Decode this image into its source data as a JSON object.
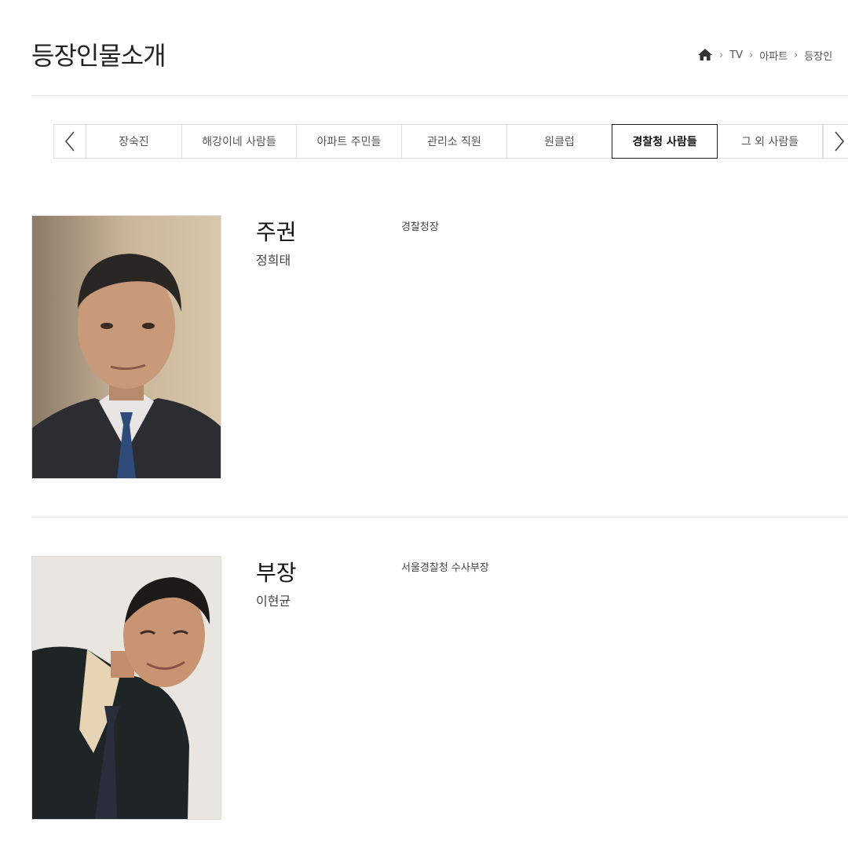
{
  "page": {
    "title": "등장인물소개"
  },
  "breadcrumb": {
    "items": [
      "TV",
      "아파트",
      "등장인"
    ]
  },
  "tabs": {
    "items": [
      "장숙진",
      "해강이네 사람들",
      "아파트 주민들",
      "관리소 직원",
      "원클럽",
      "경찰청 사람들",
      "그 외 사람들"
    ],
    "active": "경찰청 사람들"
  },
  "characters": [
    {
      "name": "주권",
      "actor": "정희태",
      "role": "경찰청장"
    },
    {
      "name": "부장",
      "actor": "이현균",
      "role": "서울경찰청 수사부장"
    }
  ]
}
